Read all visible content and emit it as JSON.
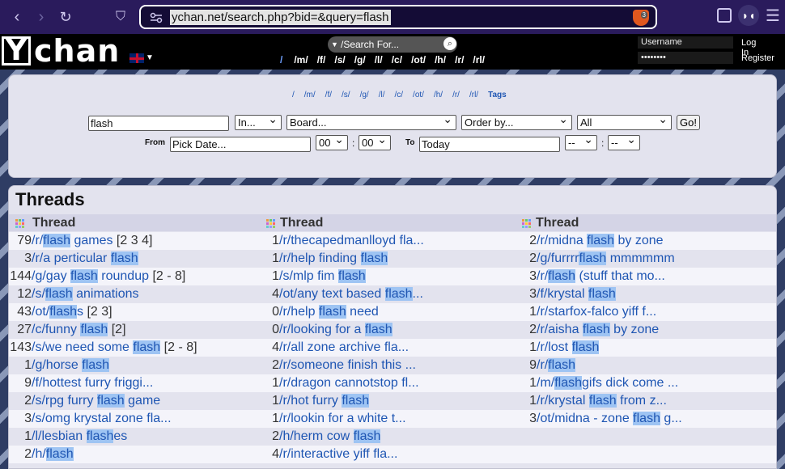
{
  "browser": {
    "url": "ychan.net/search.php?bid=&query=flash",
    "shield_count": "3"
  },
  "site": {
    "logo_letter": "Y",
    "logo_rest": "chan",
    "search_for": "/Search For...",
    "boards": [
      "/",
      "/m/",
      "/f/",
      "/s/",
      "/g/",
      "/l/",
      "/c/",
      "/ot/",
      "/h/",
      "/r/",
      "/rl/"
    ],
    "login": {
      "username_placeholder": "Username",
      "password_value": "••••••••",
      "login_label": "Log In",
      "register_label": "Register"
    }
  },
  "search": {
    "links": [
      "/",
      "/m/",
      "/f/",
      "/s/",
      "/g/",
      "/l/",
      "/c/",
      "/ot/",
      "/h/",
      "/r/",
      "/rl/",
      "Tags"
    ],
    "query": "flash",
    "in_select": "In...",
    "board_select": "Board...",
    "order_select": "Order by...",
    "all_select": "All",
    "go_label": "Go!",
    "from_label": "From",
    "from_value": "Pick Date...",
    "hour1": "00",
    "min1": "00",
    "to_label": "To",
    "to_value": "Today",
    "hour2": "--",
    "min2": "--"
  },
  "threads": {
    "title": "Threads",
    "column_header": "Thread",
    "columns": [
      [
        {
          "count": "79",
          "pre": "/r/",
          "hl": "flash",
          "post": " games",
          "pages": " [2 3 4]"
        },
        {
          "count": "3",
          "pre": "/r/a perticular ",
          "hl": "flash",
          "post": "",
          "pages": ""
        },
        {
          "count": "144",
          "pre": "/g/gay ",
          "hl": "flash",
          "post": " roundup",
          "pages": " [2 - 8]"
        },
        {
          "count": "12",
          "pre": "/s/",
          "hl": "flash",
          "post": " animations",
          "pages": ""
        },
        {
          "count": "43",
          "pre": "/ot/",
          "hl": "flash",
          "post": "s",
          "pages": " [2 3]"
        },
        {
          "count": "27",
          "pre": "/c/funny ",
          "hl": "flash",
          "post": "",
          "pages": " [2]"
        },
        {
          "count": "143",
          "pre": "/s/we need some ",
          "hl": "flash",
          "post": "",
          "pages": " [2 - 8]"
        },
        {
          "count": "1",
          "pre": "/g/horse ",
          "hl": "flash",
          "post": "",
          "pages": ""
        },
        {
          "count": "9",
          "pre": "/f/hottest furry friggi...",
          "hl": "",
          "post": "",
          "pages": ""
        },
        {
          "count": "2",
          "pre": "/s/rpg furry ",
          "hl": "flash",
          "post": " game",
          "pages": ""
        },
        {
          "count": "3",
          "pre": "/s/omg krystal zone fla...",
          "hl": "",
          "post": "",
          "pages": ""
        },
        {
          "count": "1",
          "pre": "/l/lesbian ",
          "hl": "flash",
          "post": "es",
          "pages": ""
        },
        {
          "count": "2",
          "pre": "/h/",
          "hl": "flash",
          "post": "",
          "pages": ""
        }
      ],
      [
        {
          "count": "1",
          "pre": "/r/thecapedmanlloyd fla...",
          "hl": "",
          "post": "",
          "pages": ""
        },
        {
          "count": "1",
          "pre": "/r/help finding ",
          "hl": "flash",
          "post": "",
          "pages": ""
        },
        {
          "count": "1",
          "pre": "/s/mlp fim ",
          "hl": "flash",
          "post": "",
          "pages": ""
        },
        {
          "count": "4",
          "pre": "/ot/any text based ",
          "hl": "flash",
          "post": "...",
          "pages": ""
        },
        {
          "count": "0",
          "pre": "/r/help ",
          "hl": "flash",
          "post": " need",
          "pages": ""
        },
        {
          "count": "0",
          "pre": "/r/looking for a ",
          "hl": "flash",
          "post": "",
          "pages": ""
        },
        {
          "count": "4",
          "pre": "/r/all zone archive fla...",
          "hl": "",
          "post": "",
          "pages": ""
        },
        {
          "count": "2",
          "pre": "/r/someone finish this ...",
          "hl": "",
          "post": "",
          "pages": ""
        },
        {
          "count": "1",
          "pre": "/r/dragon cannotstop fl...",
          "hl": "",
          "post": "",
          "pages": ""
        },
        {
          "count": "1",
          "pre": "/r/hot furry ",
          "hl": "flash",
          "post": "",
          "pages": ""
        },
        {
          "count": "1",
          "pre": "/r/lookin for a white t...",
          "hl": "",
          "post": "",
          "pages": ""
        },
        {
          "count": "2",
          "pre": "/h/herm cow ",
          "hl": "flash",
          "post": "",
          "pages": ""
        },
        {
          "count": "4",
          "pre": "/r/interactive yiff fla...",
          "hl": "",
          "post": "",
          "pages": ""
        }
      ],
      [
        {
          "count": "2",
          "pre": "/r/midna ",
          "hl": "flash",
          "post": " by zone",
          "pages": ""
        },
        {
          "count": "2",
          "pre": "/g/furrrr",
          "hl": "flash",
          "post": " mmmmmm",
          "pages": ""
        },
        {
          "count": "3",
          "pre": "/r/",
          "hl": "flash",
          "post": " (stuff that mo...",
          "pages": ""
        },
        {
          "count": "3",
          "pre": "/f/krystal ",
          "hl": "flash",
          "post": "",
          "pages": ""
        },
        {
          "count": "1",
          "pre": "/r/starfox-falco yiff f...",
          "hl": "",
          "post": "",
          "pages": ""
        },
        {
          "count": "2",
          "pre": "/r/aisha ",
          "hl": "flash",
          "post": " by zone",
          "pages": ""
        },
        {
          "count": "1",
          "pre": "/r/lost ",
          "hl": "flash",
          "post": "",
          "pages": ""
        },
        {
          "count": "9",
          "pre": "/r/",
          "hl": "flash",
          "post": "",
          "pages": ""
        },
        {
          "count": "1",
          "pre": "/m/",
          "hl": "flash",
          "post": "gifs dick come ...",
          "pages": ""
        },
        {
          "count": "1",
          "pre": "/r/krystal ",
          "hl": "flash",
          "post": " from z...",
          "pages": ""
        },
        {
          "count": "3",
          "pre": "/ot/midna - zone ",
          "hl": "flash",
          "post": " g...",
          "pages": ""
        }
      ]
    ]
  }
}
